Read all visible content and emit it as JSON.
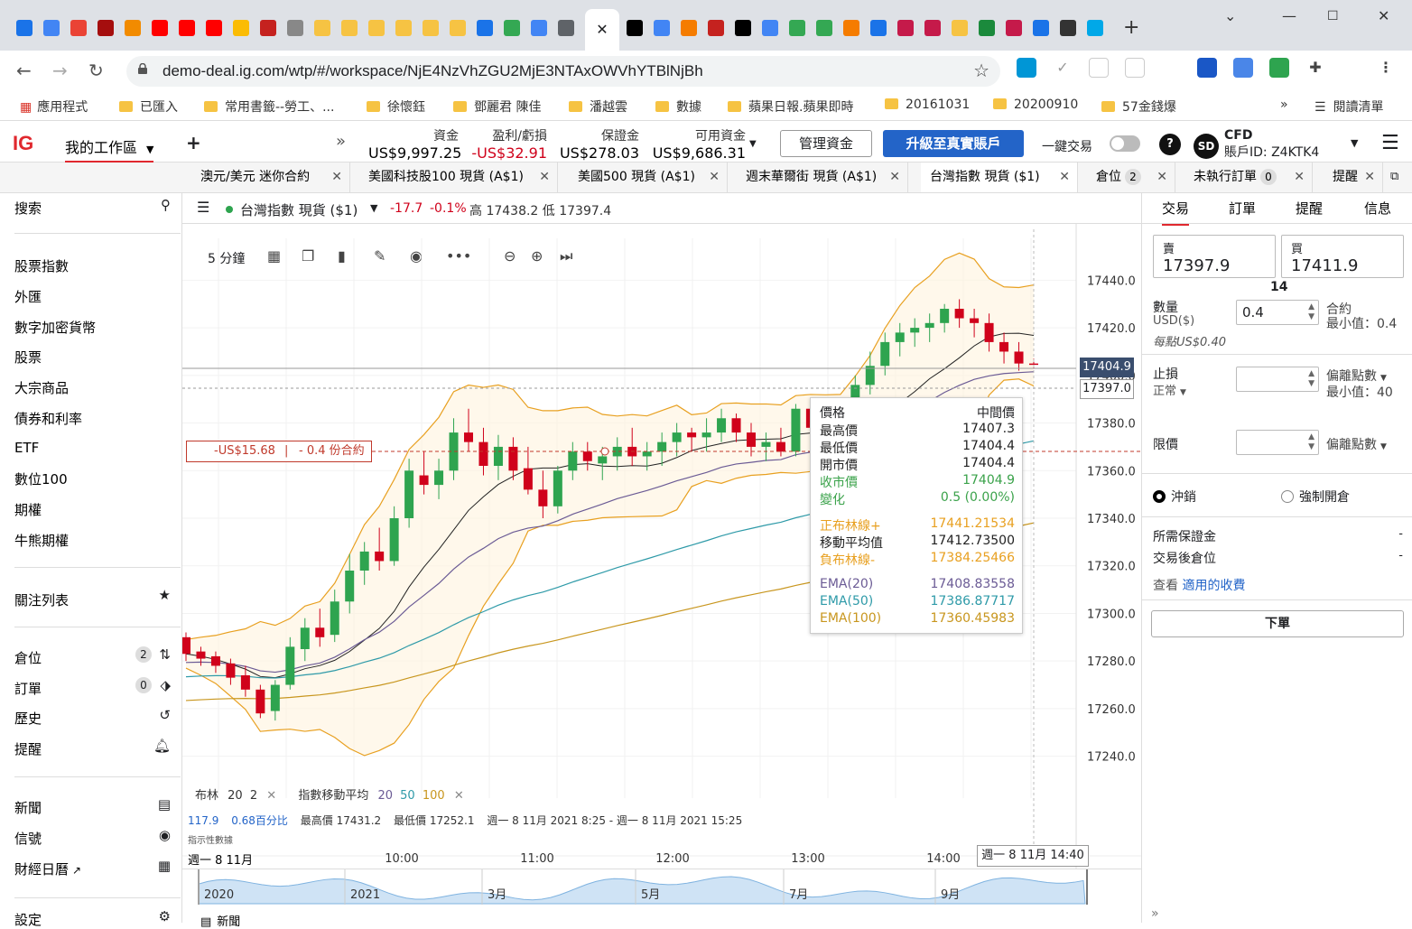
{
  "browser": {
    "url": "demo-deal.ig.com/wtp/#/workspace/NjE4NzVhZGU2MjE3NTAxOWVhYTBlNjBh",
    "bookmarks": [
      "應用程式",
      "已匯入",
      "常用書籤--勞工、...",
      "徐懷鈺",
      "鄧麗君 陳佳",
      "潘越雲",
      "數據",
      "蘋果日報.蘋果即時",
      "20161031",
      "20200910",
      "57金錢爆"
    ],
    "reading_list": "閱讀清單",
    "more": "»"
  },
  "header": {
    "logo": "IG",
    "workspace": "我的工作區",
    "metrics": [
      {
        "label": "資金",
        "value": "US$9,997.25",
        "color": "#000000"
      },
      {
        "label": "盈利/虧損",
        "value": "-US$32.91",
        "color": "#d0021b"
      },
      {
        "label": "保證金",
        "value": "US$278.03",
        "color": "#000000"
      },
      {
        "label": "可用資金",
        "value": "US$9,686.31",
        "color": "#000000"
      }
    ],
    "manage_funds": "管理資金",
    "upgrade": "升級至真實賬戶",
    "one_click": "一鍵交易",
    "avatar": "SD",
    "account_type": "CFD",
    "account_id": "賬戶ID: Z4KTK4"
  },
  "tabs": [
    {
      "label": "澳元/美元 迷你合約"
    },
    {
      "label": "美國科技股100 現貨 (A$1)"
    },
    {
      "label": "美國500 現貨 (A$1)"
    },
    {
      "label": "週末華爾街 現貨 (A$1)"
    },
    {
      "label": "台灣指數 現貨 ($1)"
    },
    {
      "label": "倉位",
      "badge": "2"
    },
    {
      "label": "未執行訂單",
      "badge": "0"
    },
    {
      "label": "提醒"
    }
  ],
  "sidebar": {
    "search": "搜索",
    "markets": [
      "股票指數",
      "外匯",
      "數字加密貨幣",
      "股票",
      "大宗商品",
      "債券和利率",
      "ETF",
      "數位100",
      "期權",
      "牛熊期權"
    ],
    "watchlist": "關注列表",
    "positions": {
      "label": "倉位",
      "count": "2"
    },
    "orders": {
      "label": "訂單",
      "count": "0"
    },
    "history": "歷史",
    "alerts": "提醒",
    "news": "新聞",
    "signals": "信號",
    "calendar": "財經日曆",
    "last": "設定"
  },
  "instrument": {
    "name": "台灣指數 現貨 ($1)",
    "change": "-17.7",
    "change_pct": "-0.1%",
    "high_low": "高 17438.2 低 17397.4"
  },
  "chart_toolbar": {
    "interval": "5 分鐘"
  },
  "position_line": {
    "pnl": "-US$15.68",
    "size": "- 0.4 份合約"
  },
  "indicators": {
    "bb": "布林",
    "bb_p1": "20",
    "bb_p2": "2",
    "ema": "指數移動平均",
    "ema1": "20",
    "ema2": "50",
    "ema3": "100"
  },
  "stats": {
    "a": "117.9",
    "b": "0.68百分比",
    "high": "最高價 17431.2",
    "low": "最低價 17252.1",
    "range": "週一 8 11月 2021 8:25 - 週一 8 11月 2021 15:25",
    "note": "指示性數據"
  },
  "time_axis": {
    "start": "週一 8 11月",
    "labels": [
      "10:00",
      "11:00",
      "12:00",
      "13:00",
      "14:00"
    ],
    "cursor": "週一 8 11月 14:40"
  },
  "navigator": {
    "labels": [
      "2020",
      "2021",
      "3月",
      "5月",
      "7月",
      "9月"
    ]
  },
  "bottom_news": "新聞",
  "tooltip": {
    "title": "價格",
    "title_r": "中間價",
    "rows": [
      {
        "k": "最高價",
        "v": "17407.3",
        "c": "#222222"
      },
      {
        "k": "最低價",
        "v": "17404.4",
        "c": "#222222"
      },
      {
        "k": "開市價",
        "v": "17404.4",
        "c": "#222222"
      },
      {
        "k": "收市價",
        "v": "17404.9",
        "c": "#3aa24a"
      },
      {
        "k": "變化",
        "v": "0.5 (0.00%)",
        "c": "#3aa24a"
      },
      {
        "k": "正布林線+",
        "v": "17441.21534",
        "c": "#e8a020"
      },
      {
        "k": "移動平均值",
        "v": "17412.73500",
        "c": "#222222"
      },
      {
        "k": "負布林線-",
        "v": "17384.25466",
        "c": "#e8a020"
      },
      {
        "k": "EMA(20)",
        "v": "17408.83558",
        "c": "#6b5b95"
      },
      {
        "k": "EMA(50)",
        "v": "17386.87717",
        "c": "#2e9aa8"
      },
      {
        "k": "EMA(100)",
        "v": "17360.45983",
        "c": "#c8961e"
      }
    ]
  },
  "trade": {
    "tabs": [
      "交易",
      "訂單",
      "提醒",
      "信息"
    ],
    "sell": {
      "label": "賣",
      "price": "17397.9"
    },
    "buy": {
      "label": "買",
      "price": "17411.9"
    },
    "spread": "14",
    "qty_label": "數量",
    "qty_unit": "USD($)",
    "qty_value": "0.4",
    "qty_r1": "合約",
    "qty_r2": "最小值：0.4",
    "per_point": "每點US$0.40",
    "stop_label": "止損",
    "stop_type": "正常",
    "stop_r1": "偏離點數",
    "stop_r2": "最小值：40",
    "limit_label": "限價",
    "limit_r1": "偏離點數",
    "opt1": "沖銷",
    "opt2": "強制開倉",
    "margin": "所需保證金",
    "after": "交易後倉位",
    "dash": "-",
    "fees_prefix": "查看",
    "fees_link": "適用的收費",
    "order_btn": "下單"
  },
  "chart_data": {
    "type": "candlestick",
    "x_labels": [
      "10:00",
      "11:00",
      "12:00",
      "13:00",
      "14:00"
    ],
    "ylim": [
      17230,
      17450
    ],
    "y_ticks": [
      17240.0,
      17260.0,
      17280.0,
      17300.0,
      17320.0,
      17340.0,
      17360.0,
      17380.0,
      17400.0,
      17420.0,
      17440.0
    ],
    "current_price": "17404.9",
    "sell_price": "17397.0",
    "candles": [
      [
        17290,
        17292,
        17280,
        17283
      ],
      [
        17284,
        17286,
        17278,
        17281
      ],
      [
        17282,
        17284,
        17275,
        17278
      ],
      [
        17279,
        17281,
        17270,
        17273
      ],
      [
        17274,
        17278,
        17265,
        17268
      ],
      [
        17268,
        17270,
        17256,
        17258
      ],
      [
        17259,
        17272,
        17255,
        17270
      ],
      [
        17270,
        17290,
        17268,
        17286
      ],
      [
        17285,
        17298,
        17280,
        17294
      ],
      [
        17294,
        17302,
        17286,
        17290
      ],
      [
        17291,
        17310,
        17288,
        17305
      ],
      [
        17305,
        17325,
        17300,
        17318
      ],
      [
        17318,
        17330,
        17312,
        17326
      ],
      [
        17326,
        17336,
        17318,
        17322
      ],
      [
        17322,
        17345,
        17320,
        17340
      ],
      [
        17340,
        17365,
        17336,
        17360
      ],
      [
        17358,
        17368,
        17350,
        17354
      ],
      [
        17354,
        17365,
        17348,
        17360
      ],
      [
        17360,
        17382,
        17356,
        17376
      ],
      [
        17376,
        17386,
        17368,
        17372
      ],
      [
        17372,
        17378,
        17358,
        17362
      ],
      [
        17362,
        17375,
        17356,
        17370
      ],
      [
        17370,
        17374,
        17356,
        17360
      ],
      [
        17361,
        17370,
        17350,
        17352
      ],
      [
        17352,
        17360,
        17340,
        17345
      ],
      [
        17345,
        17362,
        17342,
        17360
      ],
      [
        17360,
        17372,
        17356,
        17368
      ],
      [
        17368,
        17372,
        17360,
        17364
      ],
      [
        17363,
        17370,
        17356,
        17366
      ],
      [
        17366,
        17374,
        17360,
        17370
      ],
      [
        17370,
        17378,
        17362,
        17366
      ],
      [
        17366,
        17372,
        17360,
        17368
      ],
      [
        17368,
        17376,
        17362,
        17372
      ],
      [
        17372,
        17380,
        17366,
        17376
      ],
      [
        17376,
        17378,
        17368,
        17374
      ],
      [
        17374,
        17382,
        17368,
        17376
      ],
      [
        17376,
        17386,
        17372,
        17382
      ],
      [
        17382,
        17384,
        17372,
        17376
      ],
      [
        17376,
        17380,
        17366,
        17370
      ],
      [
        17370,
        17376,
        17364,
        17372
      ],
      [
        17372,
        17378,
        17366,
        17368
      ],
      [
        17368,
        17388,
        17366,
        17386
      ],
      [
        17386,
        17390,
        17374,
        17378
      ],
      [
        17378,
        17382,
        17368,
        17372
      ],
      [
        17372,
        17380,
        17366,
        17376
      ],
      [
        17376,
        17400,
        17374,
        17396
      ],
      [
        17396,
        17410,
        17392,
        17404
      ],
      [
        17404,
        17418,
        17400,
        17414
      ],
      [
        17414,
        17422,
        17408,
        17418
      ],
      [
        17418,
        17424,
        17412,
        17420
      ],
      [
        17420,
        17426,
        17414,
        17422
      ],
      [
        17422,
        17430,
        17418,
        17428
      ],
      [
        17428,
        17432,
        17420,
        17424
      ],
      [
        17424,
        17428,
        17416,
        17422
      ],
      [
        17422,
        17426,
        17410,
        17414
      ],
      [
        17414,
        17418,
        17405,
        17410
      ],
      [
        17410,
        17414,
        17402,
        17405
      ],
      [
        17405,
        17407,
        17403,
        17404.9
      ]
    ]
  }
}
